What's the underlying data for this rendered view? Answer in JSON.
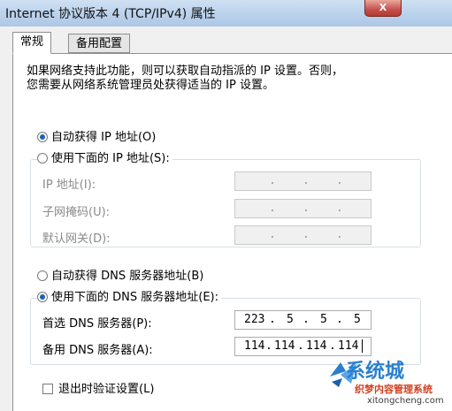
{
  "window": {
    "title": "Internet 协议版本 4 (TCP/IPv4) 属性",
    "close_label": "X"
  },
  "tabs": [
    {
      "label": "常规"
    },
    {
      "label": "备用配置"
    }
  ],
  "description": [
    "如果网络支持此功能，则可以获取自动指派的 IP 设置。否则，",
    "您需要从网络系统管理员处获得适当的 IP 设置。"
  ],
  "ip": {
    "auto_label": "自动获得 IP 地址(O)",
    "manual_label": "使用下面的 IP 地址(S):",
    "auto_selected": true,
    "fields": [
      {
        "label": "IP 地址(I):",
        "value": ""
      },
      {
        "label": "子网掩码(U):",
        "value": ""
      },
      {
        "label": "默认网关(D):",
        "value": ""
      }
    ]
  },
  "dns": {
    "auto_label": "自动获得 DNS 服务器地址(B)",
    "manual_label": "使用下面的 DNS 服务器地址(E):",
    "manual_selected": true,
    "preferred_label": "首选 DNS 服务器(P):",
    "preferred_octets": [
      "223",
      "5",
      "5",
      "5"
    ],
    "alternate_label": "备用 DNS 服务器(A):",
    "alternate_octets": [
      "114",
      "114",
      "114",
      "114"
    ]
  },
  "validate_label": "退出时验证设置(L)",
  "watermark": {
    "title": "系统城",
    "subtitle": "织梦内容管理系统",
    "url": "xitongcheng.com"
  },
  "colors": {
    "accent": "#1f5fb4",
    "titlebar": "#bcd3ec"
  }
}
